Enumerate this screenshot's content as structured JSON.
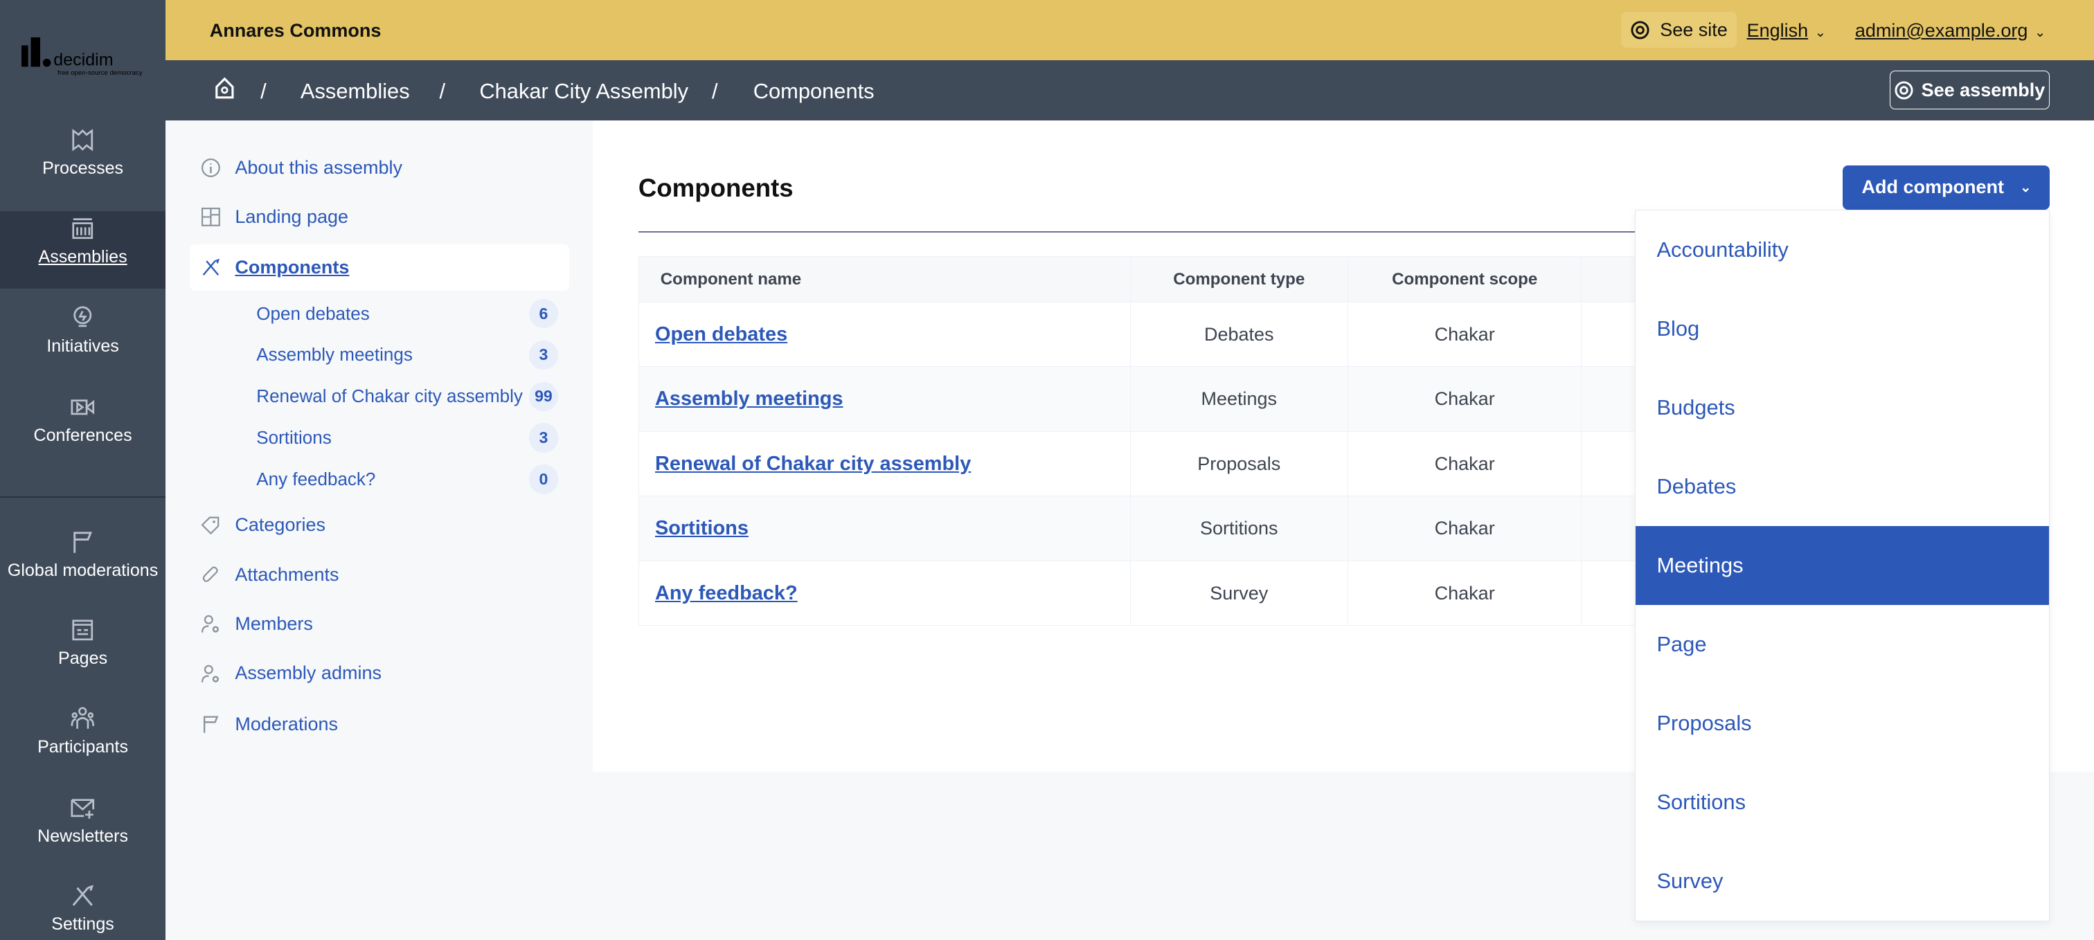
{
  "brand": {
    "logo_text": "decidim",
    "logo_tagline": "free open-source democracy"
  },
  "rail": {
    "items": [
      {
        "label": "Processes",
        "icon": "process-map-icon",
        "active": false
      },
      {
        "label": "Assemblies",
        "icon": "assembly-building-icon",
        "active": true
      },
      {
        "label": "Initiatives",
        "icon": "lightbulb-icon",
        "active": false
      },
      {
        "label": "Conferences",
        "icon": "video-icon",
        "active": false
      },
      {
        "label": "Global moderations",
        "icon": "flag-icon",
        "active": false
      },
      {
        "label": "Pages",
        "icon": "page-icon",
        "active": false
      },
      {
        "label": "Participants",
        "icon": "people-icon",
        "active": false
      },
      {
        "label": "Newsletters",
        "icon": "mail-plus-icon",
        "active": false
      },
      {
        "label": "Settings",
        "icon": "tools-icon",
        "active": false
      }
    ]
  },
  "topbar": {
    "organization": "Annares Commons",
    "see_site": "See site",
    "language": "English",
    "user": "admin@example.org"
  },
  "breadcrumb": {
    "items": [
      "Assemblies",
      "Chakar City Assembly",
      "Components"
    ],
    "separator": "/",
    "see_assembly": "See assembly"
  },
  "sidebar": {
    "items": [
      {
        "label": "About this assembly",
        "icon": "info-icon"
      },
      {
        "label": "Landing page",
        "icon": "layout-icon"
      },
      {
        "label": "Components",
        "icon": "tools-icon",
        "active": true
      },
      {
        "label": "Categories",
        "icon": "tag-icon"
      },
      {
        "label": "Attachments",
        "icon": "paperclip-icon"
      },
      {
        "label": "Members",
        "icon": "user-gear-icon"
      },
      {
        "label": "Assembly admins",
        "icon": "user-gear-icon"
      },
      {
        "label": "Moderations",
        "icon": "flag-icon"
      }
    ],
    "components": [
      {
        "label": "Open debates",
        "count": "6"
      },
      {
        "label": "Assembly meetings",
        "count": "3"
      },
      {
        "label": "Renewal of Chakar city assembly",
        "count": "99"
      },
      {
        "label": "Sortitions",
        "count": "3"
      },
      {
        "label": "Any feedback?",
        "count": "0"
      }
    ]
  },
  "main": {
    "title": "Components",
    "add_button": "Add component",
    "columns": [
      "Component name",
      "Component type",
      "Component scope"
    ],
    "rows": [
      {
        "name": "Open debates",
        "type": "Debates",
        "scope": "Chakar"
      },
      {
        "name": "Assembly meetings",
        "type": "Meetings",
        "scope": "Chakar"
      },
      {
        "name": "Renewal of Chakar city assembly",
        "type": "Proposals",
        "scope": "Chakar"
      },
      {
        "name": "Sortitions",
        "type": "Sortitions",
        "scope": "Chakar"
      },
      {
        "name": "Any feedback?",
        "type": "Survey",
        "scope": "Chakar"
      }
    ],
    "dropdown": {
      "items": [
        "Accountability",
        "Blog",
        "Budgets",
        "Debates",
        "Meetings",
        "Page",
        "Proposals",
        "Sortitions",
        "Survey"
      ],
      "highlighted": "Meetings"
    }
  },
  "colors": {
    "primary": "#2c58b8",
    "topbar": "#e3c363",
    "rail": "#404b5a"
  }
}
